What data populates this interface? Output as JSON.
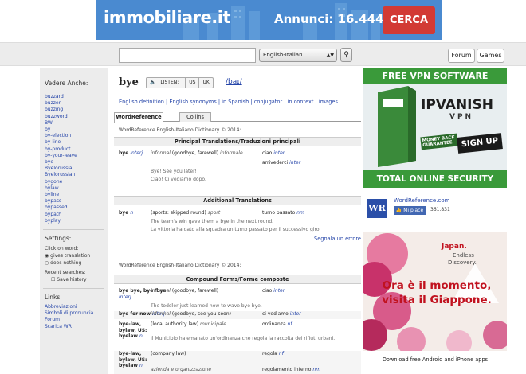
{
  "top_ad": {
    "brand": "immobiliare.it",
    "count_text": "Annunci: 16.444",
    "button": "CERCA"
  },
  "search": {
    "value": "",
    "dictionary": "English-Italian",
    "search_icon": "magnifier-icon"
  },
  "header_buttons": {
    "forum": "Forum",
    "games": "Games"
  },
  "sidebar": {
    "see_also_title": "Vedere Anche:",
    "see_also": [
      "buzzard",
      "buzzer",
      "buzzing",
      "buzzword",
      "BW",
      "by",
      "by-election",
      "by-line",
      "by-product",
      "by-your-leave",
      "bye",
      "Byelorussia",
      "Byelorussian",
      "bygone",
      "bylaw",
      "byline",
      "bypass",
      "bypassed",
      "bypath",
      "byplay"
    ],
    "settings_title": "Settings:",
    "click_on_word": "Click on word:",
    "opt_translation": "gives translation",
    "opt_nothing": "does nothing",
    "recent_searches": "Recent searches:",
    "save_history": "Save history",
    "links_title": "Links:",
    "links": [
      "Abbreviazioni",
      "Simboli di pronuncia",
      "Forum",
      "Scarica WR"
    ]
  },
  "entry": {
    "headword": "bye",
    "listen": "LISTEN:",
    "us": "US",
    "uk": "UK",
    "ipa": "/baɪ/",
    "links": "English definition | English synonyms | in Spanish | conjugator | in context | images",
    "tabs": [
      "WordReference",
      "Collins"
    ],
    "dict_label_1": "WordReference English-Italiano Dictionary © 2014:",
    "principal_head": "Principal Translations/Traduzioni principali",
    "p_row_word": "bye",
    "p_row_pos": "interj",
    "p_row_def_a": "informal",
    "p_row_def_b": "(goodbye, farewell)",
    "p_row_def_c": "informale",
    "p_row_to1": "ciao",
    "p_row_to1_pos": "inter",
    "p_row_to2": "arrivederci",
    "p_row_to2_pos": "inter",
    "p_ex1": "Bye! See you later!",
    "p_ex2": "Ciao! Ci vediamo dopo.",
    "additional_head": "Additional Translations",
    "a_row_word": "bye",
    "a_row_pos": "n",
    "a_row_def": "(sports: skipped round)",
    "a_row_def_b": "sport",
    "a_row_to": "turno passato",
    "a_row_to_pos": "nm",
    "a_ex1": "The team's win gave them a bye in the next round.",
    "a_ex2": "La vittoria ha dato alla squadra un turno passato per il successivo giro.",
    "report": "Segnala un errore",
    "dict_label_2": "WordReference English-Italiano Dictionary © 2014:",
    "compound_head": "Compound Forms/Forme composte",
    "c1_word": "bye bye, bye 'bye",
    "c1_pos": "interj",
    "c1_def": "informal",
    "c1_def_b": "(goodbye, farewell)",
    "c1_to": "ciao",
    "c1_to_pos": "inter",
    "c1_ex": "The toddler just learned how to wave bye bye.",
    "c2_word": "bye for now",
    "c2_pos": "interj",
    "c2_def": "informal",
    "c2_def_b": "(goodbye, see you soon)",
    "c2_to": "ci vediamo",
    "c2_to_pos": "inter",
    "c3_word": "bye-law, bylaw, US: byelaw",
    "c3_pos": "n",
    "c3_def": "(local authority law)",
    "c3_def_b": "municipale",
    "c3_to": "ordinanza",
    "c3_to_pos": "nf",
    "c3_ex": "Il Municipio ha emanato un'ordinanza che regola la raccolta dei rifiuti urbani.",
    "c4_word": "bye-law, bylaw, US: byelaw",
    "c4_pos": "n",
    "c4_def": "(company law)",
    "c4_to": "regola",
    "c4_to_pos": "nf",
    "c4_def2": "azienda e organizzazione",
    "c4_to2": "regolamento interno",
    "c4_to2_pos": "nm"
  },
  "right": {
    "vpn_title": "FREE VPN SOFTWARE",
    "vpn_brand": "IPVANISH",
    "vpn_sub": "VPN",
    "vpn_badge": "MONEY BACK GUARANTEE",
    "vpn_signup": "SIGN UP",
    "vpn_footer": "TOTAL ONLINE SECURITY",
    "wr_name": "WordReference.com",
    "wr_like": "Mi piace",
    "wr_count": "361.831",
    "jp_brand": "Japan.",
    "jp_tag1": "Endless",
    "jp_tag2": "Discovery.",
    "jp_head1": "Ora è il momento,",
    "jp_head2": "visita il Giappone.",
    "download": "Download free Android and iPhone apps"
  }
}
